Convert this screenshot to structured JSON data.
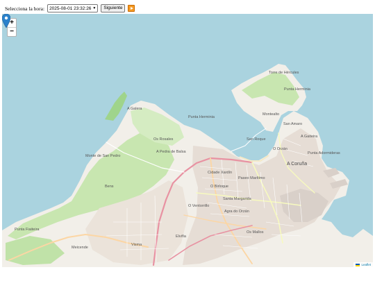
{
  "toolbar": {
    "label": "Selecciona la hora:",
    "selected_time": "2025-08-01 23:32:26",
    "next_button": "Siguiente",
    "play_icon": "play-icon",
    "accent_color": "#f59a23"
  },
  "map": {
    "zoom_in": "+",
    "zoom_out": "−",
    "attribution": "Leaflet",
    "labels": {
      "city": "A Coruña",
      "os_rosales": "Os Rosales",
      "a_pedra": "A Pedra de Balsa",
      "a_galera": "A Galera",
      "punta_herminia": "Punta Herminia",
      "montealto": "Montealto",
      "a_gaiteira": "A Gaiteira",
      "ciudad_jardin": "Cidade Xardín",
      "o_ventorrillo": "O Ventorrillo",
      "santa_margarida": "Santa Margarida",
      "os_mallos": "Os Mallos",
      "o_birloque": "O Birloque",
      "agra_do_orzan": "Agra do Orzán",
      "paseo_maritimo": "Paseo Marítimo",
      "monte_san_pedro": "Monte de San Pedro",
      "torre_hercules": "Torre de Hércules",
      "punta_herminia_n": "Punta Herminia",
      "punta_de_adormideras": "Punta Adormideras",
      "o_orzan": "O Orzán",
      "san_roque": "San Roque",
      "san_amaro": "San Amaro",
      "elvina": "Elviña",
      "bens": "Bens",
      "meicende": "Meicende",
      "visma": "Visma",
      "punta_fiaiteira": "Punta Fiaiteira"
    }
  }
}
